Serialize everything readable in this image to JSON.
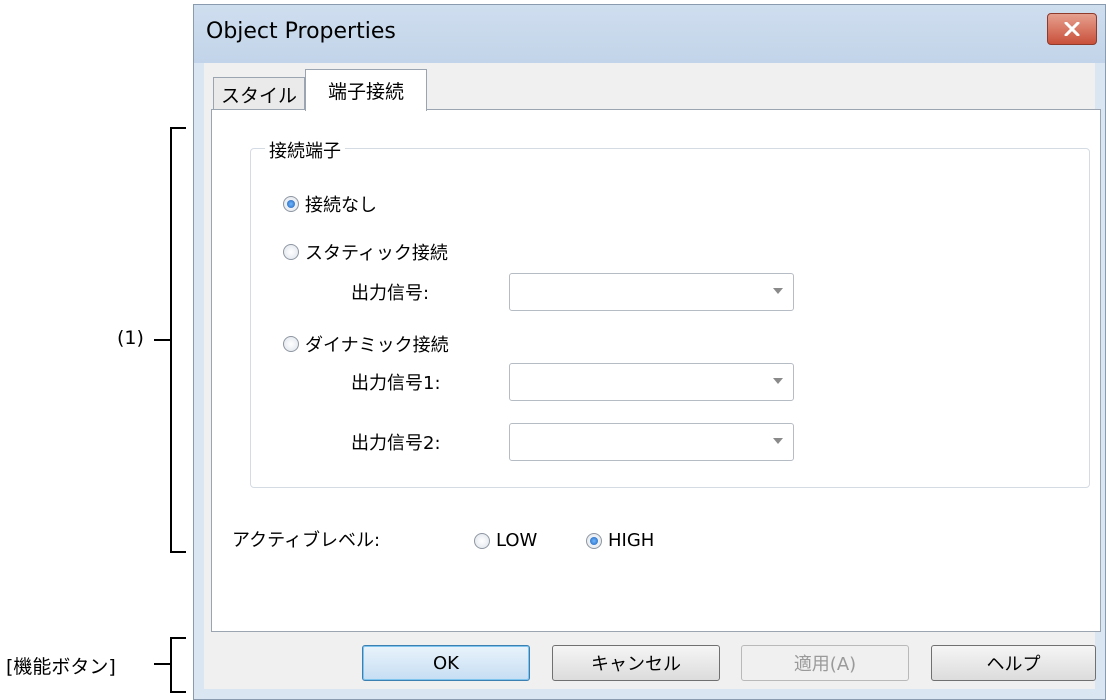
{
  "annotations": {
    "section1_label": "(1)",
    "function_buttons_label": "[機能ボタン]"
  },
  "window": {
    "title": "Object Properties",
    "close_icon": "close-icon"
  },
  "tabs": [
    {
      "label": "スタイル"
    },
    {
      "label": "端子接続"
    }
  ],
  "connection_group": {
    "legend": "接続端子",
    "options": {
      "none": "接続なし",
      "static": "スタティック接続",
      "dynamic": "ダイナミック接続"
    },
    "selected": "none",
    "fields": {
      "output": "出力信号:",
      "output1": "出力信号1:",
      "output2": "出力信号2:"
    }
  },
  "active_level": {
    "label": "アクティブレベル:",
    "low": "LOW",
    "high": "HIGH",
    "selected": "HIGH"
  },
  "buttons": {
    "ok": "OK",
    "cancel": "キャンセル",
    "apply": "適用(A)",
    "help": "ヘルプ"
  }
}
